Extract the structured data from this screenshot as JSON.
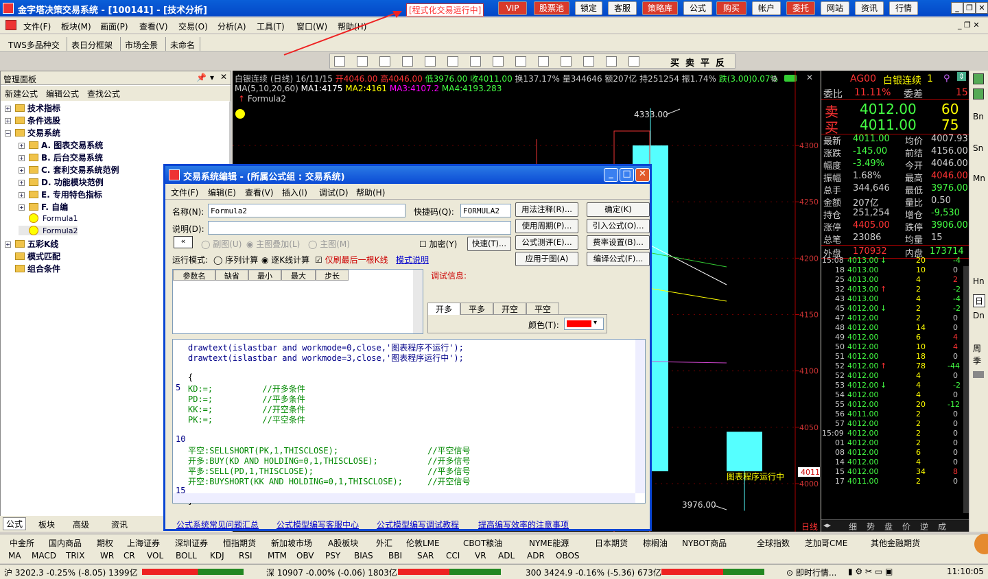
{
  "app": {
    "title": "金字塔决策交易系统 - [100141] - [技术分析]",
    "program_status": "[程式化交易运行中]",
    "top_buttons": [
      "VIP",
      "股票池",
      "锁定",
      "客服",
      "策略库",
      "公式",
      "购买",
      "帐户",
      "委托",
      "网站",
      "资讯",
      "行情"
    ]
  },
  "menu": [
    "文件(F)",
    "板块(M)",
    "画面(P)",
    "查看(V)",
    "交易(O)",
    "分析(A)",
    "工具(T)",
    "窗口(W)",
    "帮助(H)"
  ],
  "toolbar_tabs": [
    "TWS多品种交",
    "表日分框架",
    "市场全景",
    "未命名"
  ],
  "draw_tools_text": [
    "买",
    "卖",
    "平",
    "反"
  ],
  "manager": {
    "title": "管理面板",
    "actions": [
      "新建公式",
      "编辑公式",
      "查找公式"
    ],
    "tree": [
      {
        "label": "技术指标",
        "level": 0
      },
      {
        "label": "条件选股",
        "level": 0
      },
      {
        "label": "交易系统",
        "level": 0
      },
      {
        "label": "A. 图表交易系统",
        "level": 1
      },
      {
        "label": "B. 后台交易系统",
        "level": 1
      },
      {
        "label": "C. 套利交易系统范例",
        "level": 1
      },
      {
        "label": "D. 功能模块范例",
        "level": 1
      },
      {
        "label": "E. 专用特色指标",
        "level": 1
      },
      {
        "label": "F. 自编",
        "level": 1
      },
      {
        "label": "Formula1",
        "level": 1
      },
      {
        "label": "Formula2",
        "level": 1
      },
      {
        "label": "五彩K线",
        "level": 0
      },
      {
        "label": "模式匹配",
        "level": 0
      },
      {
        "label": "组合条件",
        "level": 0
      }
    ],
    "bottom_tabs": [
      "公式",
      "板块",
      "高级",
      "资讯"
    ]
  },
  "chart": {
    "header": "白银连续 (日线) 16/11/15",
    "open": "开4046.00",
    "high": "高4046.00",
    "low": "低3976.00",
    "close": "收4011.00",
    "turnover": "换137.17%",
    "volume": "量344646",
    "amount": "额207亿",
    "hold": "持251254",
    "amp": "振1.74%",
    "chg": "跌(3.00)0.07%",
    "ma_label": "MA(5,10,20,60)",
    "ma1": "MA1:4175",
    "ma2": "MA2:4161",
    "ma3": "MA3:4107.2",
    "ma4": "MA4:4193.283",
    "formula": "Formula2",
    "top_price": "4333.00",
    "bottom_price": "3976.00",
    "running_label": "图表程序运行中",
    "current_price_tag": "4011",
    "period_tab": "日线",
    "y_ticks": [
      "4300",
      "4250",
      "4200",
      "4150",
      "4100",
      "4050",
      "4000"
    ]
  },
  "chart_data": {
    "type": "candlestick",
    "y_ticks": [
      4300,
      4250,
      4200,
      4150,
      4100,
      4050,
      4000
    ],
    "candles": [
      {
        "open": 4300,
        "high": 4333,
        "low": 3980,
        "close": 4011
      },
      {
        "open": 4046,
        "high": 4046,
        "low": 3976,
        "close": 4011
      }
    ]
  },
  "quote": {
    "symbol": "AG00",
    "name": "白银连续",
    "num": "1",
    "wei_bi_label": "委比",
    "wei_bi": "11.11%",
    "wei_cha_label": "委差",
    "wei_cha": "15",
    "sell_label": "卖",
    "sell_price": "4012.00",
    "sell_vol": "60",
    "buy_label": "买",
    "buy_price": "4011.00",
    "buy_vol": "75",
    "rows": [
      [
        "最新",
        "4011.00",
        "均价",
        "4007.93"
      ],
      [
        "涨跌",
        "-145.00",
        "前结",
        "4156.00"
      ],
      [
        "幅度",
        "-3.49%",
        "今开",
        "4046.00"
      ],
      [
        "振幅",
        "1.68%",
        "最高",
        "4046.00"
      ],
      [
        "总手",
        "344,646",
        "最低",
        "3976.00"
      ],
      [
        "金额",
        "207亿",
        "量比",
        "0.50"
      ],
      [
        "持仓",
        "251,254",
        "增仓",
        "-9,530"
      ],
      [
        "涨停",
        "4405.00",
        "跌停",
        "3906.00"
      ],
      [
        "总笔",
        "23086",
        "均量",
        "15"
      ]
    ],
    "outer_label": "外盘",
    "outer": "170932",
    "inner_label": "内盘",
    "inner": "173714",
    "ticks": [
      [
        "15:08",
        "4013.00",
        "↓",
        "20",
        "-4"
      ],
      [
        "18",
        "4013.00",
        "",
        "10",
        "0"
      ],
      [
        "25",
        "4013.00",
        "",
        "4",
        "2"
      ],
      [
        "32",
        "4013.00",
        "↑",
        "2",
        "-2"
      ],
      [
        "43",
        "4013.00",
        "",
        "4",
        "-4"
      ],
      [
        "45",
        "4012.00",
        "↓",
        "2",
        "-2"
      ],
      [
        "47",
        "4012.00",
        "",
        "2",
        "0"
      ],
      [
        "48",
        "4012.00",
        "",
        "14",
        "0"
      ],
      [
        "49",
        "4012.00",
        "",
        "6",
        "4"
      ],
      [
        "50",
        "4012.00",
        "",
        "10",
        "4"
      ],
      [
        "51",
        "4012.00",
        "",
        "18",
        "0"
      ],
      [
        "52",
        "4012.00",
        "↑",
        "78",
        "-44"
      ],
      [
        "52",
        "4012.00",
        "",
        "4",
        "0"
      ],
      [
        "53",
        "4012.00",
        "↓",
        "4",
        "-2"
      ],
      [
        "54",
        "4012.00",
        "",
        "4",
        "0"
      ],
      [
        "55",
        "4012.00",
        "",
        "20",
        "-12"
      ],
      [
        "56",
        "4011.00",
        "",
        "2",
        "0"
      ],
      [
        "57",
        "4012.00",
        "",
        "2",
        "0"
      ],
      [
        "15:09",
        "4012.00",
        "",
        "2",
        "0"
      ],
      [
        "01",
        "4012.00",
        "",
        "2",
        "0"
      ],
      [
        "08",
        "4012.00",
        "",
        "6",
        "0"
      ],
      [
        "14",
        "4012.00",
        "",
        "4",
        "0"
      ],
      [
        "15",
        "4012.00",
        "",
        "34",
        "8"
      ],
      [
        "17",
        "4011.00",
        "",
        "2",
        "0"
      ]
    ],
    "bottom_tabs": [
      "细",
      "势",
      "盘",
      "价",
      "逆",
      "成"
    ]
  },
  "right_sidebar": [
    "Bn",
    "Sn",
    "Mn",
    "Hn",
    "日",
    "Dn",
    "周",
    "季"
  ],
  "dialog": {
    "title": "交易系统编辑 - (所属公式组 : 交易系统)",
    "menu": [
      "文件(F)",
      "编辑(E)",
      "查看(V)",
      "插入(I)",
      "调试(D)",
      "帮助(H)"
    ],
    "name_label": "名称(N):",
    "name_value": "Formula2",
    "shortcut_label": "快捷码(Q):",
    "shortcut_value": "FORMULA2",
    "desc_label": "说明(D):",
    "desc_value": "",
    "radio_sub": "副图(U)",
    "radio_overlay": "主图叠加(L)",
    "radio_main": "主图(M)",
    "encrypt": "加密(Y)",
    "quick": "快速(T)...",
    "run_mode_label": "运行模式:",
    "seq_calc": "序列计算",
    "kline_calc": "逐K线计算",
    "refresh_last": "仅刷最后一根K线",
    "mode_help": "模式说明",
    "buttons": [
      "用法注释(R)...",
      "确定(K)",
      "使用周期(P)...",
      "引入公式(O)...",
      "公式测评(E)...",
      "费率设置(B)...",
      "应用于图(A)",
      "编译公式(F)..."
    ],
    "params_headers": [
      "参数名",
      "缺省",
      "最小",
      "最大",
      "步长"
    ],
    "debug_label": "调试信息:",
    "trade_tabs": [
      "开多",
      "平多",
      "开空",
      "平空"
    ],
    "color_label": "颜色(T):",
    "code_lines": [
      {
        "ln": "",
        "text": "drawtext(islastbar and workmode=0,close,'图表程序不运行');"
      },
      {
        "ln": "",
        "text": "drawtext(islastbar and workmode=3,close,'图表程序运行中');"
      },
      {
        "ln": "",
        "text": ""
      },
      {
        "ln": "",
        "text": "{"
      },
      {
        "ln": "5",
        "text": "KD:=;          //开多条件"
      },
      {
        "ln": "",
        "text": "PD:=;          //平多条件"
      },
      {
        "ln": "",
        "text": "KK:=;          //开空条件"
      },
      {
        "ln": "",
        "text": "PK:=;          //平空条件"
      },
      {
        "ln": "",
        "text": ""
      },
      {
        "ln": "10",
        "text": ""
      },
      {
        "ln": "",
        "text": "平空:SELLSHORT(PK,1,THISCLOSE);                  //平空信号"
      },
      {
        "ln": "",
        "text": "开多:BUY(KD AND HOLDING=0,1,THISCLOSE);          //开多信号"
      },
      {
        "ln": "",
        "text": "平多:SELL(PD,1,THISCLOSE);                       //平多信号"
      },
      {
        "ln": "",
        "text": "开空:BUYSHORT(KK AND HOLDING=0,1,THISCLOSE);     //开空信号"
      },
      {
        "ln": "15",
        "text": ""
      },
      {
        "ln": "",
        "text": "}"
      }
    ],
    "links": [
      "公式系统常见问题汇总",
      "公式模型编写客服中心",
      "公式模型编写调试教程",
      "提高编写效率的注意事项"
    ]
  },
  "market_tabs": [
    "中金所",
    "国内商品",
    "期权",
    "上海证券",
    "深圳证券",
    "恒指期货",
    "新加坡市场",
    "A股板块",
    "外汇",
    "伦敦LME",
    "CBOT粮油",
    "NYME能源",
    "日本期货",
    "棕榈油",
    "NYBOT商品",
    "全球指数",
    "芝加哥CME",
    "其他金融期货"
  ],
  "indicators": [
    "MA",
    "MACD",
    "TRIX",
    "WR",
    "CR",
    "VOL",
    "BOLL",
    "KDJ",
    "RSI",
    "MTM",
    "OBV",
    "PSY",
    "BIAS",
    "BBI",
    "SAR",
    "CCI",
    "VR",
    "ADL",
    "ADR",
    "OBOS"
  ],
  "status": {
    "sh": "沪 3202.3 -0.25% (-8.05) 1399亿",
    "sz": "深 10907 -0.00% (-0.06) 1803亿",
    "hs300": "300 3424.9 -0.16% (-5.36) 673亿",
    "msg": "即时行情...",
    "time": "11:10:05"
  }
}
